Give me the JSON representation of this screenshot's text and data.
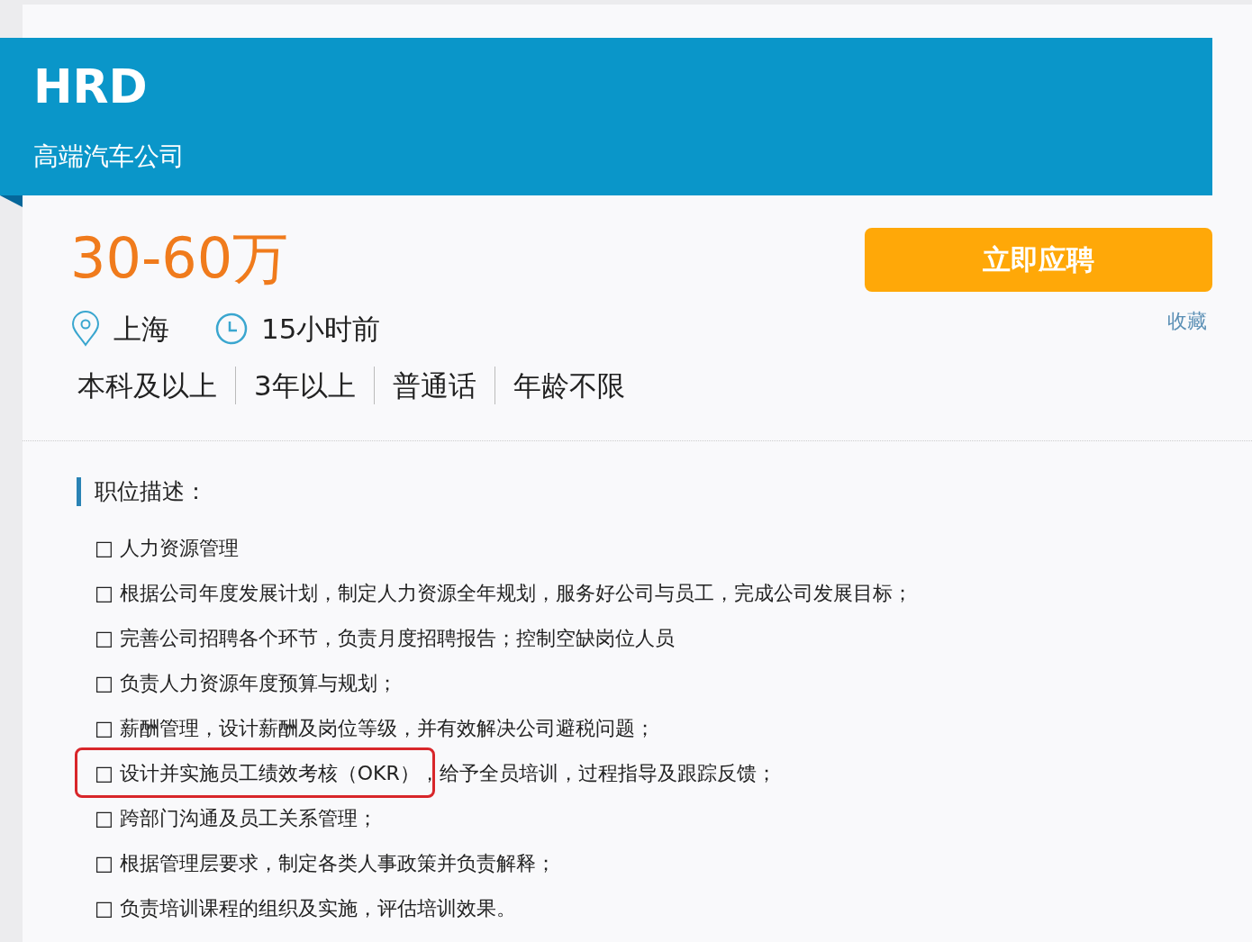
{
  "header": {
    "title": "HRD",
    "company": "高端汽车公司"
  },
  "salary": "30-60万",
  "apply_button": "立即应聘",
  "favorite_link": "收藏",
  "meta": {
    "location": "上海",
    "posted": "15小时前"
  },
  "requirements": [
    "本科及以上",
    "3年以上",
    "普通话",
    "年龄不限"
  ],
  "description": {
    "heading": "职位描述：",
    "items": [
      {
        "text": "□ 人力资源管理",
        "highlighted": false
      },
      {
        "text": "□ 根据公司年度发展计划，制定人力资源全年规划，服务好公司与员工，完成公司发展目标；",
        "highlighted": false
      },
      {
        "text": "□ 完善公司招聘各个环节，负责月度招聘报告；控制空缺岗位人员",
        "highlighted": false
      },
      {
        "text": "□ 负责人力资源年度预算与规划；",
        "highlighted": false
      },
      {
        "text": "□ 薪酬管理，设计薪酬及岗位等级，并有效解决公司避税问题；",
        "highlighted": false
      },
      {
        "text": "□ 设计并实施员工绩效考核（OKR），给予全员培训，过程指导及跟踪反馈；",
        "highlighted": true
      },
      {
        "text": "□ 跨部门沟通及员工关系管理；",
        "highlighted": false
      },
      {
        "text": "□ 根据管理层要求，制定各类人事政策并负责解释；",
        "highlighted": false
      },
      {
        "text": "□ 负责培训课程的组织及实施，评估培训效果。",
        "highlighted": false
      }
    ]
  }
}
